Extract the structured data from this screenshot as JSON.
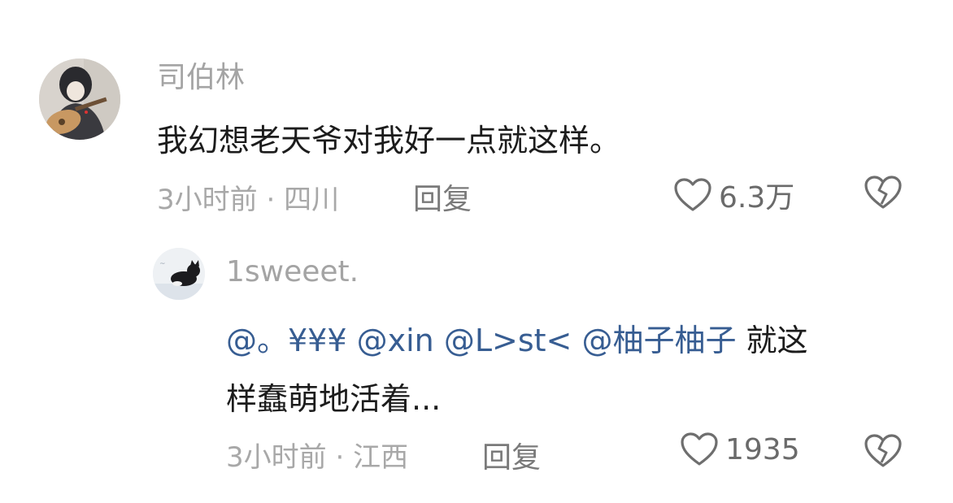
{
  "comments": [
    {
      "username": "司伯林",
      "text": "我幻想老天爷对我好一点就这样。",
      "time": "3小时前",
      "location": "四川",
      "reply_label": "回复",
      "likes": "6.3万"
    }
  ],
  "reply": {
    "username": "1sweeet.",
    "mentions": "@。¥¥¥ @xin @L>st< @柚子柚子",
    "text_line1_rest": " 就这",
    "text_line2": "样蠢萌地活着...",
    "time": "3小时前",
    "location": "江西",
    "reply_label": "回复",
    "likes": "1935"
  },
  "meta_separator": " · ",
  "colors": {
    "username": "#a4a4a4",
    "body_text": "#1c1c1c",
    "mention": "#375d92",
    "meta": "#a8a8a8"
  },
  "icons": [
    "heart-outline-icon",
    "broken-heart-icon"
  ]
}
